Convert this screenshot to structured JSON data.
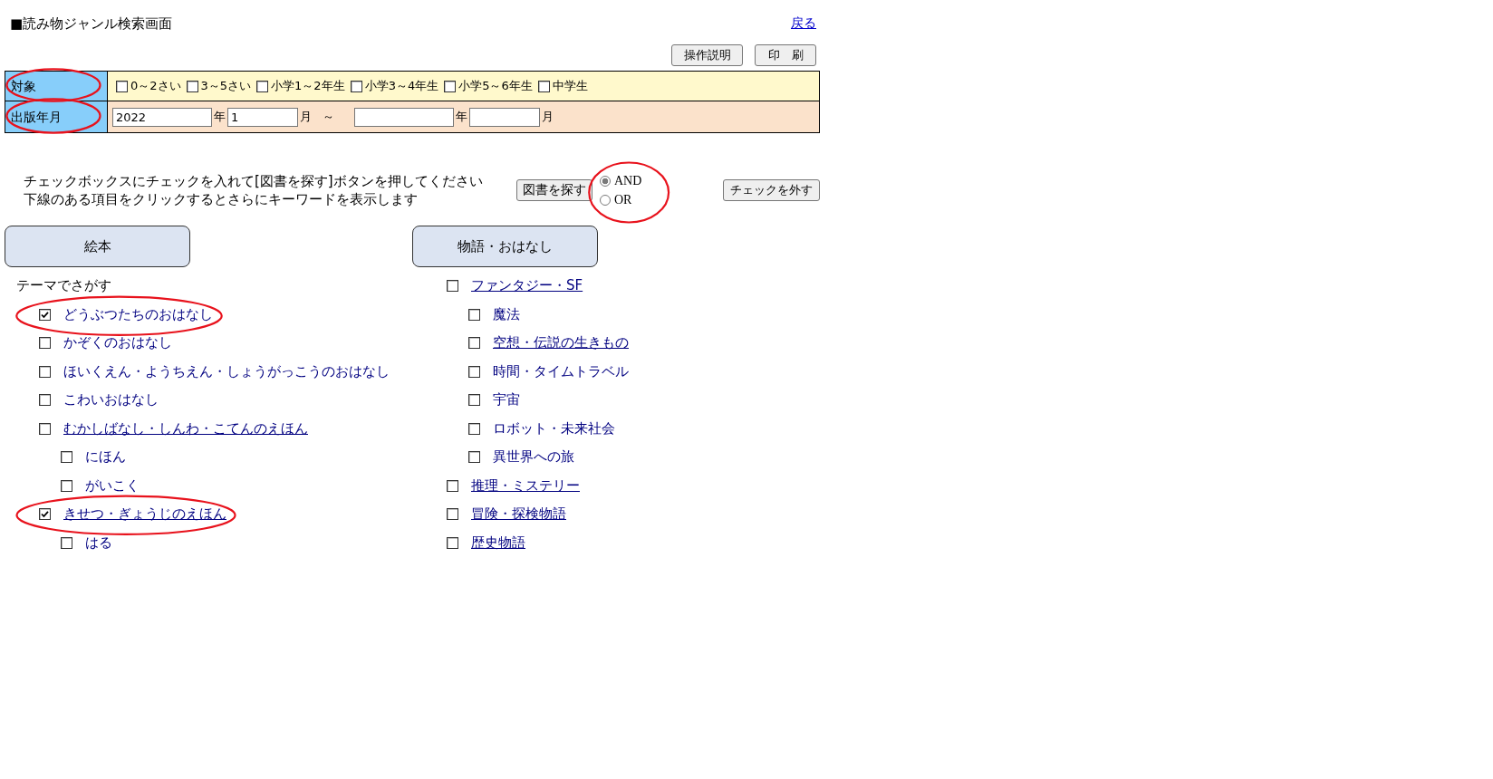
{
  "header": {
    "title": "■読み物ジャンル検索画面",
    "back_link": "戻る"
  },
  "toolbar": {
    "buttons": [
      {
        "kind": "help",
        "label": "操作説明"
      },
      {
        "kind": "print",
        "label": "印　刷"
      }
    ]
  },
  "form": {
    "rows": [
      {
        "kind": "checkboxes",
        "label": "対象",
        "circled": true,
        "options": [
          {
            "label": "0～2さい",
            "checked": false
          },
          {
            "label": "3～5さい",
            "checked": false
          },
          {
            "label": "小学1～2年生",
            "checked": false
          },
          {
            "label": "小学3～4年生",
            "checked": false
          },
          {
            "label": "小学5～6年生",
            "checked": false
          },
          {
            "label": "中学生",
            "checked": false
          }
        ]
      },
      {
        "kind": "date_range",
        "label": "出版年月",
        "circled": true,
        "parts": [
          {
            "kind": "year",
            "value": "2022"
          },
          {
            "kind": "unit",
            "text": "年"
          },
          {
            "kind": "month",
            "value": "1"
          },
          {
            "kind": "unit",
            "text": "月"
          },
          {
            "kind": "separator",
            "text": "～"
          },
          {
            "kind": "year"
          },
          {
            "kind": "unit",
            "text": "年"
          },
          {
            "kind": "month"
          },
          {
            "kind": "unit",
            "text": "月"
          }
        ]
      }
    ]
  },
  "search": {
    "instructions": [
      "チェックボックスにチェックを入れて[図書を探す]ボタンを押してください",
      "下線のある項目をクリックするとさらにキーワードを表示します"
    ],
    "search_button": "図書を探す",
    "match_mode": {
      "circled": true,
      "options": [
        {
          "label": "AND",
          "selected": true
        },
        {
          "label": "OR",
          "selected": false
        }
      ]
    },
    "clear_button": "チェックを外す"
  },
  "genres": [
    {
      "label": "絵本",
      "heading": "テーマでさがす",
      "items": [
        {
          "label": "どうぶつたちのおはなし",
          "checked": true,
          "link": false,
          "circled": true
        },
        {
          "label": "かぞくのおはなし",
          "checked": false,
          "link": false,
          "circled": false
        },
        {
          "label": "ほいくえん・ようちえん・しょうがっこうのおはなし",
          "checked": false,
          "link": false,
          "circled": false
        },
        {
          "label": "こわいおはなし",
          "checked": false,
          "link": false,
          "circled": false
        },
        {
          "label": "むかしばなし・しんわ・こてんのえほん",
          "checked": false,
          "link": true,
          "circled": false,
          "children": [
            {
              "label": "にほん",
              "checked": false,
              "link": false,
              "circled": false
            },
            {
              "label": "がいこく",
              "checked": false,
              "link": false,
              "circled": false
            }
          ]
        },
        {
          "label": "きせつ・ぎょうじのえほん",
          "checked": true,
          "link": true,
          "circled": true,
          "children": [
            {
              "label": "はる",
              "checked": false,
              "link": false,
              "circled": false
            }
          ]
        }
      ]
    },
    {
      "label": "物語・おはなし",
      "items": [
        {
          "label": "ファンタジー・SF",
          "checked": false,
          "link": true,
          "circled": false,
          "children": [
            {
              "label": "魔法",
              "checked": false,
              "link": false,
              "circled": false
            },
            {
              "label": "空想・伝説の生きもの",
              "checked": false,
              "link": true,
              "circled": false
            },
            {
              "label": "時間・タイムトラベル",
              "checked": false,
              "link": false,
              "circled": false
            },
            {
              "label": "宇宙",
              "checked": false,
              "link": false,
              "circled": false
            },
            {
              "label": "ロボット・未来社会",
              "checked": false,
              "link": false,
              "circled": false
            },
            {
              "label": "異世界への旅",
              "checked": false,
              "link": false,
              "circled": false
            }
          ]
        },
        {
          "label": "推理・ミステリー",
          "checked": false,
          "link": true,
          "circled": false
        },
        {
          "label": "冒険・探検物語",
          "checked": false,
          "link": true,
          "circled": false
        },
        {
          "label": "歴史物語",
          "checked": false,
          "link": true,
          "circled": false
        }
      ]
    }
  ]
}
